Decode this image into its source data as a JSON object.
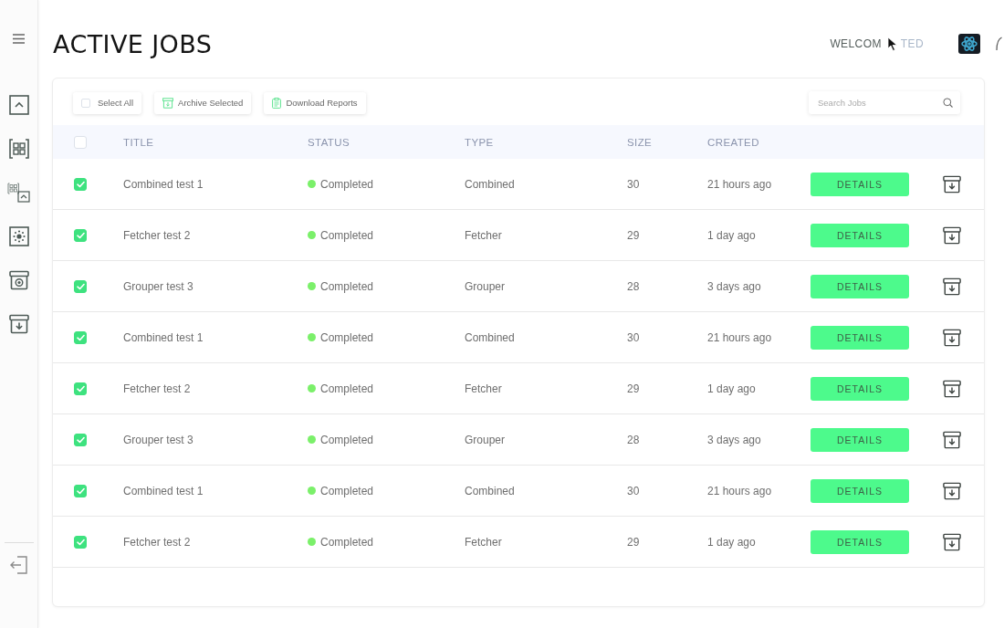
{
  "header": {
    "title": "ACTIVE JOBS",
    "greeting": "WELCOM",
    "greeting_tail": "TED"
  },
  "toolbar": {
    "select_all": {
      "label": "Select All",
      "checked": false
    },
    "buttons": [
      {
        "label": "Archive Selected",
        "kind": "archive"
      },
      {
        "label": "Download Reports",
        "kind": "report"
      }
    ],
    "search": {
      "placeholder": "Search Jobs"
    }
  },
  "table": {
    "header_checked": false,
    "columns": [
      "TITLE",
      "STATUS",
      "TYPE",
      "SIZE",
      "CREATED"
    ],
    "rows": [
      {
        "checked": true,
        "title": "Combined test 1",
        "status": "Completed",
        "type": "Combined",
        "size": "30",
        "created": "21 hours ago",
        "action": "DETAILS"
      },
      {
        "checked": true,
        "title": "Fetcher test 2",
        "status": "Completed",
        "type": "Fetcher",
        "size": "29",
        "created": "1 day ago",
        "action": "DETAILS"
      },
      {
        "checked": true,
        "title": "Grouper test 3",
        "status": "Completed",
        "type": "Grouper",
        "size": "28",
        "created": "3 days ago",
        "action": "DETAILS"
      },
      {
        "checked": true,
        "title": "Combined test 1",
        "status": "Completed",
        "type": "Combined",
        "size": "30",
        "created": "21 hours ago",
        "action": "DETAILS"
      },
      {
        "checked": true,
        "title": "Fetcher test 2",
        "status": "Completed",
        "type": "Fetcher",
        "size": "29",
        "created": "1 day ago",
        "action": "DETAILS"
      },
      {
        "checked": true,
        "title": "Grouper test 3",
        "status": "Completed",
        "type": "Grouper",
        "size": "28",
        "created": "3 days ago",
        "action": "DETAILS"
      },
      {
        "checked": true,
        "title": "Combined test 1",
        "status": "Completed",
        "type": "Combined",
        "size": "30",
        "created": "21 hours ago",
        "action": "DETAILS"
      },
      {
        "checked": true,
        "title": "Fetcher test 2",
        "status": "Completed",
        "type": "Fetcher",
        "size": "29",
        "created": "1 day ago",
        "action": "DETAILS"
      }
    ]
  }
}
